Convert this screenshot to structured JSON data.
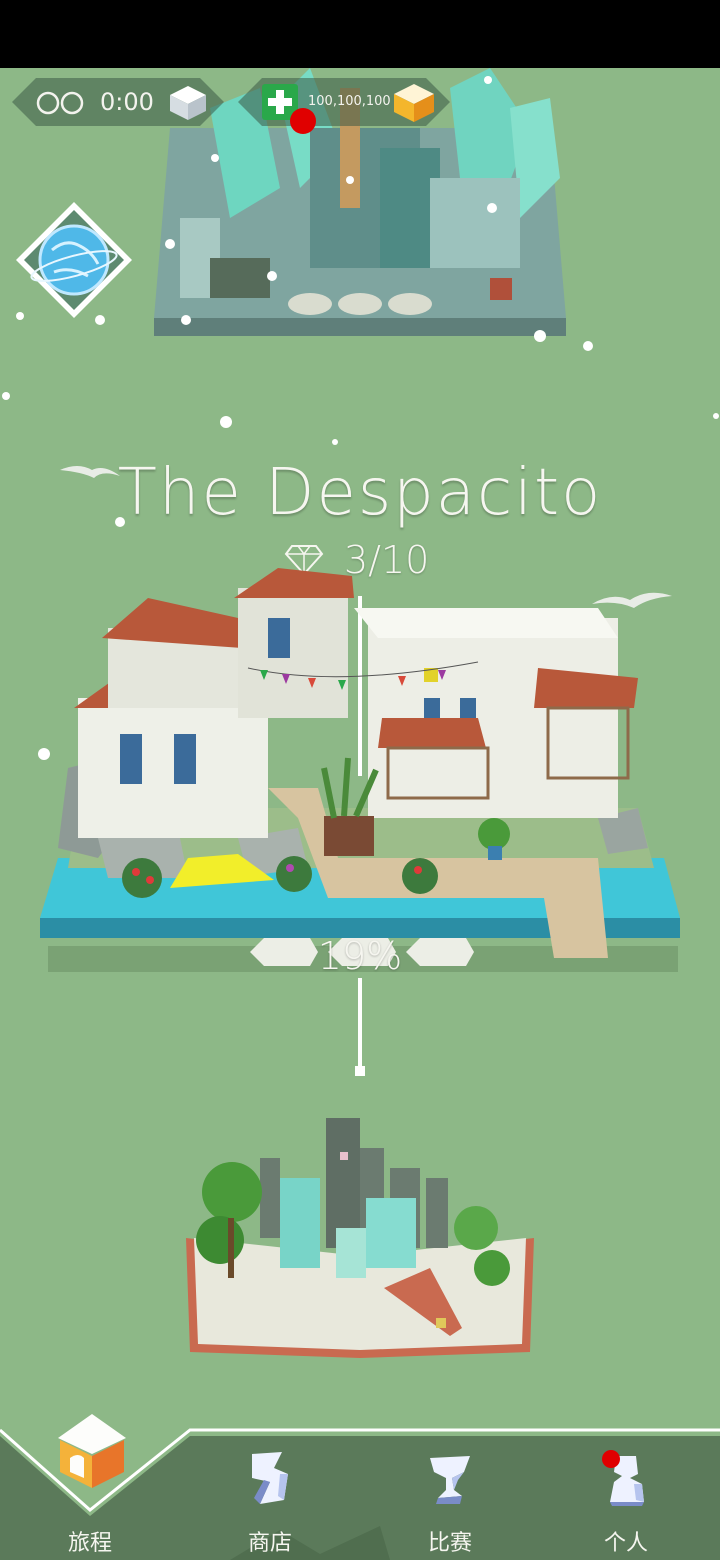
{
  "hud": {
    "timer": "0:00",
    "currency": "100,100,100"
  },
  "level": {
    "title": "The Despacito",
    "gems": "3/10",
    "progress": "19%",
    "progress_value": 0.19
  },
  "nav": {
    "journey": "旅程",
    "shop": "商店",
    "compete": "比赛",
    "profile": "个人"
  },
  "colors": {
    "background": "#8db887",
    "water": "#3cc8d8",
    "roof": "#b8583a",
    "accent_green": "#2aa84a",
    "notification": "#e00000"
  }
}
